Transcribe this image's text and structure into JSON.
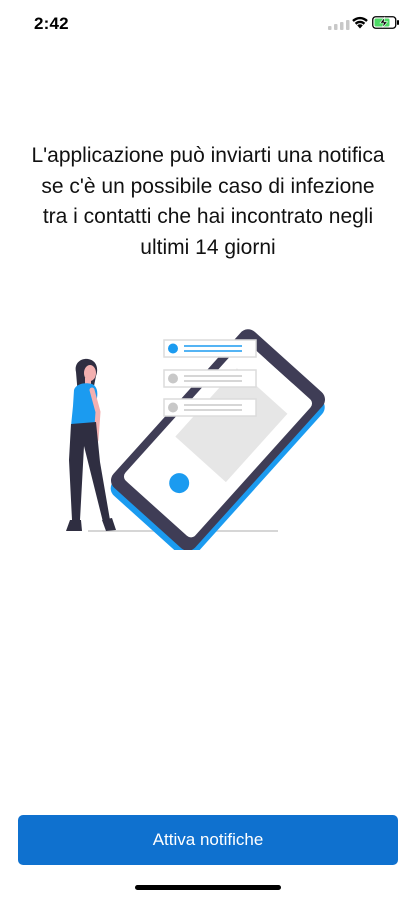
{
  "status_bar": {
    "time": "2:42",
    "icons": [
      "signal-icon",
      "wifi-icon",
      "battery-charging-icon"
    ]
  },
  "onboarding": {
    "message": "L'applicazione può inviarti una notifica se c'è un possibile caso di infezione tra i contatti che hai incontrato negli ultimi 14 giorni",
    "illustration": "person-with-phone-notifications-illustration"
  },
  "actions": {
    "enable_notifications_label": "Attiva notifiche"
  },
  "colors": {
    "accent": "#0f71cf",
    "illustration_blue": "#1b9bf0",
    "phone_dark": "#3f3d56",
    "text": "#111111"
  }
}
